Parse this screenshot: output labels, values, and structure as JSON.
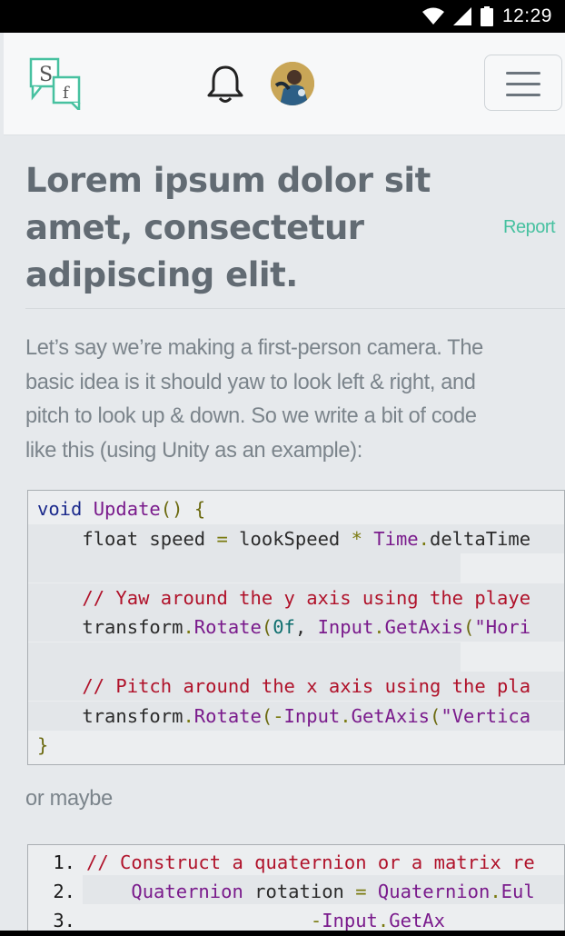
{
  "status_bar": {
    "time": "12:29",
    "icons": [
      "wifi-icon",
      "signal-icon",
      "battery-icon"
    ]
  },
  "header": {
    "logo_letters": [
      "S",
      "f"
    ],
    "icons": [
      "bell-icon",
      "avatar",
      "hamburger-menu-icon"
    ]
  },
  "post": {
    "title_lines": [
      "Lorem ipsum dolor sit",
      "amet, consectetur",
      "adipiscing elit."
    ],
    "report_label": "Report",
    "paragraph_lines": [
      "Let’s say we’re making a first-person camera. The",
      "basic idea is it should yaw to look left & right, and",
      "pitch to look up & down. So we write a bit of code",
      "like this (using Unity as an example):"
    ],
    "or_maybe": "or maybe"
  },
  "code1": {
    "lines": [
      "void Update() {",
      "    float speed = lookSpeed * Time.deltaTime",
      "",
      "    // Yaw around the y axis using the playe",
      "    transform.Rotate(0f, Input.GetAxis(\"Hori",
      "",
      "    // Pitch around the x axis using the pla",
      "    transform.Rotate(-Input.GetAxis(\"Vertica",
      "}"
    ]
  },
  "code2": {
    "line_numbers": [
      "1.",
      "2.",
      "3."
    ],
    "lines": [
      "// Construct a quaternion or a matrix re",
      "    Quaternion rotation = Quaternion.Eul",
      "                    -Input.GetAx"
    ]
  },
  "colors": {
    "accent": "#47c1a0",
    "title": "#626b73",
    "body_text": "#7b848b",
    "background": "#e6e9ec",
    "comment": "#b0122a",
    "keyword_purple": "#7a1b8c",
    "keyword_blue": "#1b2a8c"
  }
}
